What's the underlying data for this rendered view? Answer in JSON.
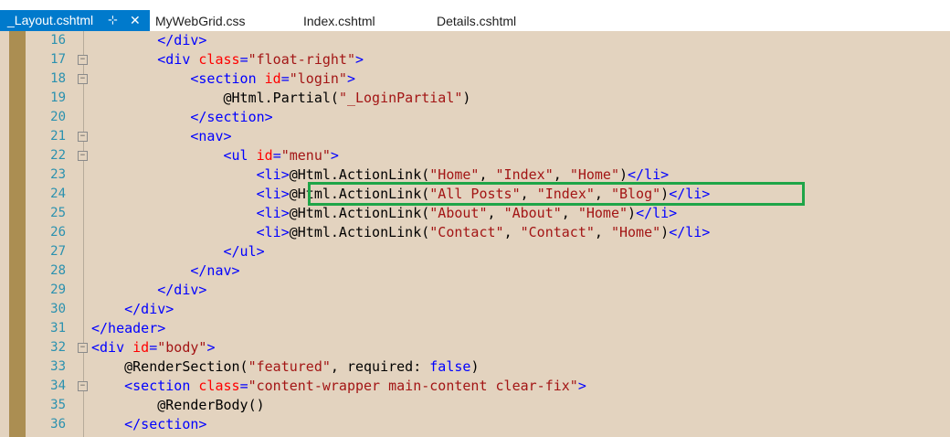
{
  "tabs": [
    {
      "label": "_Layout.cshtml",
      "active": true,
      "pin": "⊹",
      "close": "✕"
    },
    {
      "label": "MyWebGrid.css",
      "active": false
    },
    {
      "label": "Index.cshtml",
      "active": false
    },
    {
      "label": "Details.cshtml",
      "active": false
    }
  ],
  "colors": {
    "tag": "#0000ff",
    "attribute": "#ff0000",
    "string": "#a31515",
    "highlight_border": "#1fa548",
    "active_tab": "#007acc"
  },
  "lines": [
    {
      "number": "16",
      "fold": "",
      "tokens": [
        [
          "t",
          "        </div>"
        ]
      ]
    },
    {
      "number": "17",
      "fold": "−",
      "tokens": [
        [
          "t",
          "        <div "
        ],
        [
          "a",
          "class"
        ],
        [
          "t",
          "="
        ],
        [
          "s",
          "\"float-right\""
        ],
        [
          "t",
          ">"
        ]
      ]
    },
    {
      "number": "18",
      "fold": "−",
      "tokens": [
        [
          "t",
          "            <section "
        ],
        [
          "a",
          "id"
        ],
        [
          "t",
          "="
        ],
        [
          "s",
          "\"login\""
        ],
        [
          "t",
          ">"
        ]
      ]
    },
    {
      "number": "19",
      "fold": "",
      "tokens": [
        [
          "r",
          "                @Html.Partial("
        ],
        [
          "s",
          "\"_LoginPartial\""
        ],
        [
          "r",
          ")"
        ]
      ]
    },
    {
      "number": "20",
      "fold": "",
      "tokens": [
        [
          "t",
          "            </section>"
        ]
      ]
    },
    {
      "number": "21",
      "fold": "−",
      "tokens": [
        [
          "t",
          "            <nav>"
        ]
      ]
    },
    {
      "number": "22",
      "fold": "−",
      "tokens": [
        [
          "t",
          "                <ul "
        ],
        [
          "a",
          "id"
        ],
        [
          "t",
          "="
        ],
        [
          "s",
          "\"menu\""
        ],
        [
          "t",
          ">"
        ]
      ]
    },
    {
      "number": "23",
      "fold": "",
      "tokens": [
        [
          "t",
          "                    <li>"
        ],
        [
          "r",
          "@Html.ActionLink("
        ],
        [
          "s",
          "\"Home\""
        ],
        [
          "r",
          ", "
        ],
        [
          "s",
          "\"Index\""
        ],
        [
          "r",
          ", "
        ],
        [
          "s",
          "\"Home\""
        ],
        [
          "r",
          ")"
        ],
        [
          "t",
          "</li>"
        ]
      ]
    },
    {
      "number": "24",
      "fold": "",
      "tokens": [
        [
          "t",
          "                    <li>"
        ],
        [
          "r",
          "@Html.ActionLink("
        ],
        [
          "s",
          "\"All Posts\""
        ],
        [
          "r",
          ", "
        ],
        [
          "s",
          "\"Index\""
        ],
        [
          "r",
          ", "
        ],
        [
          "s",
          "\"Blog\""
        ],
        [
          "r",
          ")"
        ],
        [
          "t",
          "</li>"
        ]
      ]
    },
    {
      "number": "25",
      "fold": "",
      "tokens": [
        [
          "t",
          "                    <li>"
        ],
        [
          "r",
          "@Html.ActionLink("
        ],
        [
          "s",
          "\"About\""
        ],
        [
          "r",
          ", "
        ],
        [
          "s",
          "\"About\""
        ],
        [
          "r",
          ", "
        ],
        [
          "s",
          "\"Home\""
        ],
        [
          "r",
          ")"
        ],
        [
          "t",
          "</li>"
        ]
      ]
    },
    {
      "number": "26",
      "fold": "",
      "tokens": [
        [
          "t",
          "                    <li>"
        ],
        [
          "r",
          "@Html.ActionLink("
        ],
        [
          "s",
          "\"Contact\""
        ],
        [
          "r",
          ", "
        ],
        [
          "s",
          "\"Contact\""
        ],
        [
          "r",
          ", "
        ],
        [
          "s",
          "\"Home\""
        ],
        [
          "r",
          ")"
        ],
        [
          "t",
          "</li>"
        ]
      ]
    },
    {
      "number": "27",
      "fold": "",
      "tokens": [
        [
          "t",
          "                </ul>"
        ]
      ]
    },
    {
      "number": "28",
      "fold": "",
      "tokens": [
        [
          "t",
          "            </nav>"
        ]
      ]
    },
    {
      "number": "29",
      "fold": "",
      "tokens": [
        [
          "t",
          "        </div>"
        ]
      ]
    },
    {
      "number": "30",
      "fold": "",
      "tokens": [
        [
          "t",
          "    </div>"
        ]
      ]
    },
    {
      "number": "31",
      "fold": "",
      "tokens": [
        [
          "t",
          "</header>"
        ]
      ]
    },
    {
      "number": "32",
      "fold": "−",
      "tokens": [
        [
          "t",
          "<div "
        ],
        [
          "a",
          "id"
        ],
        [
          "t",
          "="
        ],
        [
          "s",
          "\"body\""
        ],
        [
          "t",
          ">"
        ]
      ]
    },
    {
      "number": "33",
      "fold": "",
      "tokens": [
        [
          "r",
          "    @RenderSection("
        ],
        [
          "s",
          "\"featured\""
        ],
        [
          "r",
          ", required: "
        ],
        [
          "t",
          "false"
        ],
        [
          "r",
          ")"
        ]
      ]
    },
    {
      "number": "34",
      "fold": "−",
      "tokens": [
        [
          "t",
          "    <section "
        ],
        [
          "a",
          "class"
        ],
        [
          "t",
          "="
        ],
        [
          "s",
          "\"content-wrapper main-content clear-fix\""
        ],
        [
          "t",
          ">"
        ]
      ]
    },
    {
      "number": "35",
      "fold": "",
      "tokens": [
        [
          "r",
          "        @RenderBody()"
        ]
      ]
    },
    {
      "number": "36",
      "fold": "",
      "tokens": [
        [
          "t",
          "    </section>"
        ]
      ]
    }
  ]
}
